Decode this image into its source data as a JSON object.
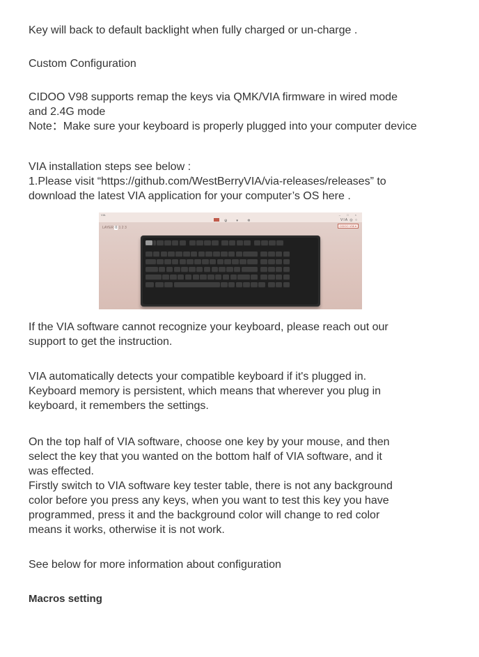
{
  "paragraphs": {
    "p1": "Key will back to default backlight when fully charged or un-charge .",
    "p2": "Custom Configuration",
    "p3_l1": "CIDOO V98 supports remap the keys via QMK/VIA firmware  in wired mode",
    "p3_l2": "and 2.4G mode",
    "p3_l3": "Note：Make sure your keyboard is properly plugged into your computer device",
    "p4_l1": "VIA  installation steps see below :",
    "p4_l2": "1.Please visit “https://github.com/WestBerryVIA/via-releases/releases” to",
    "p4_l3": "download the latest VIA application for your computer’s  OS here .",
    "p5_l1": "If the VIA software cannot recognize your keyboard, please reach out our",
    "p5_l2": "support to get the instruction.",
    "p6_l1": "VIA automatically detects your compatible keyboard if it's plugged in.",
    "p6_l2": "Keyboard memory is persistent, which means that wherever you plug in",
    "p6_l3": "keyboard, it remembers the settings.",
    "p7_l1": "On the top half of VIA software, choose one key by your mouse, and then",
    "p7_l2": "select the key that you wanted on the bottom half of VIA software, and it",
    "p7_l3": "was effected.",
    "p7_l4": "Firstly switch to VIA software key tester table, there is not any background",
    "p7_l5": "color before you press any keys, when you want to test this key you have",
    "p7_l6": "programmed, press it and the background color will change to red color",
    "p7_l7": "means it works, otherwise it is not work.",
    "p8": "See below for more information about configuration",
    "heading": "Macros setting"
  },
  "via_screenshot": {
    "window_title": "VIA",
    "window_controls": "– □ ×",
    "nav_icons": [
      "keyboard-icon",
      "usb-icon",
      "debug-icon",
      "settings-icon"
    ],
    "brand": "VIA",
    "layer_label": "LAYER",
    "layers": [
      "0",
      "1",
      "2",
      "3"
    ],
    "device": "CIDOO V98 ▾",
    "colors": {
      "background": "#dec6bf",
      "keyboard_case": "#2b2b2b",
      "keycap": "#3d3d3d",
      "accent": "#c05a4a"
    }
  }
}
